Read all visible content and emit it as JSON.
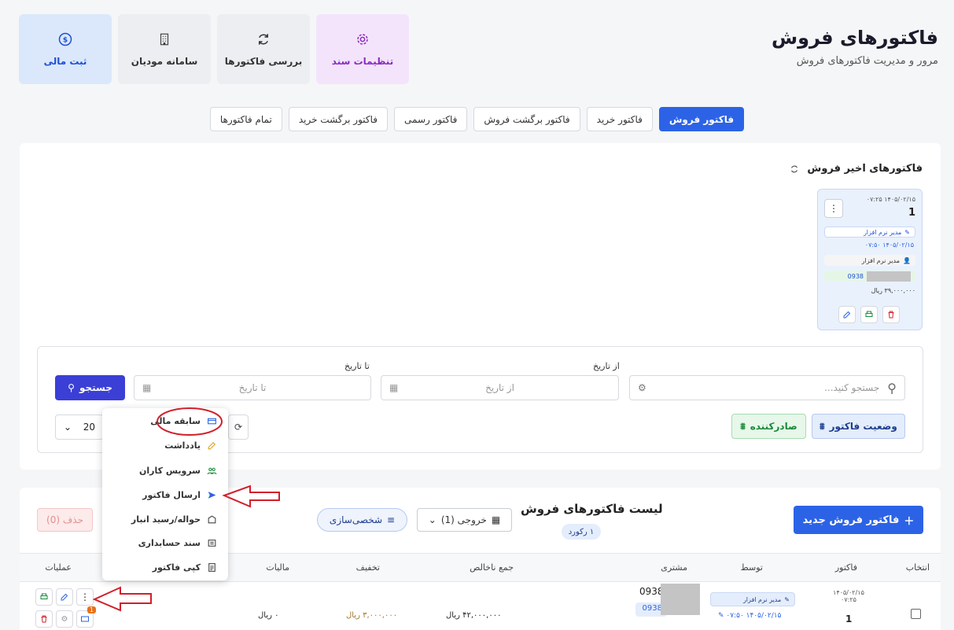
{
  "header": {
    "title": "فاکتورهای فروش",
    "subtitle": "مرور و مدیریت فاکتورهای فروش"
  },
  "tiles": [
    {
      "label": "ثبت مالی",
      "icon": "dollar-circle-icon"
    },
    {
      "label": "سامانه مودیان",
      "icon": "building-icon"
    },
    {
      "label": "بررسی فاکتورها",
      "icon": "refresh-icon"
    },
    {
      "label": "تنظیمات سند",
      "icon": "gear-icon"
    }
  ],
  "tabs": [
    "فاکتور فروش",
    "فاکتور خرید",
    "فاکتور برگشت فروش",
    "فاکتور رسمی",
    "فاکتور برگشت خرید",
    "تمام فاکتورها"
  ],
  "recent": {
    "title": "فاکتورهای اخیر فروش",
    "card": {
      "date": "۱۴۰۵/۰۲/۱۵",
      "time": "۰۷:۲۵",
      "number": "1",
      "creator": "مدیر نرم افزار",
      "created_date": "۱۴۰۵/۰۲/۱۵",
      "created_time": "۰۷:۵۰",
      "customer": "مدیر نرم افزار",
      "phone": "0938",
      "amount": "۳۹,۰۰۰,۰۰۰ ریال"
    }
  },
  "filters": {
    "search_placeholder": "جستجو کنید...",
    "from_label": "از تاریخ",
    "from_placeholder": "از تاریخ",
    "to_label": "تا تاریخ",
    "to_placeholder": "تا تاریخ",
    "search_button": "جستجو",
    "status_button": "وضعیت فاکتور",
    "issuer_button": "صادرکننده",
    "page_size": "20"
  },
  "list": {
    "title": "لیست فاکتورهای فروش",
    "count": "۱ رکورد",
    "new_button": "فاکتور فروش جدید",
    "export_button": "خروجی (1)",
    "customize_button": "شخصی‌سازی",
    "delete_button": "حذف (0)",
    "columns": [
      "انتخاب",
      "فاکتور",
      "توسط",
      "مشتری",
      "جمع ناخالص",
      "تخفیف",
      "مالیات",
      "عملیات"
    ],
    "row": {
      "date": "۱۴۰۵/۰۲/۱۵",
      "time": "۰۷:۲۵",
      "number": "1",
      "by": "مدیر نرم افزار",
      "by_date": "۱۴۰۵/۰۲/۱۵",
      "by_time": "۰۷:۵۰",
      "phone": "0938",
      "phone2": "0938",
      "gross": "۴۲,۰۰۰,۰۰۰ ریال",
      "discount": "۳,۰۰۰,۰۰۰ ریال",
      "tax": "۰ ریال",
      "badge": "1"
    }
  },
  "menu": [
    "سابقه مالی",
    "یادداشت",
    "سرویس کاران",
    "ارسال فاکتور",
    "حواله/رسید انبار",
    "سند حسابداری",
    "کپی فاکتور"
  ],
  "colors": {
    "primary": "#2c63e6",
    "annotation": "#d21f2a"
  }
}
